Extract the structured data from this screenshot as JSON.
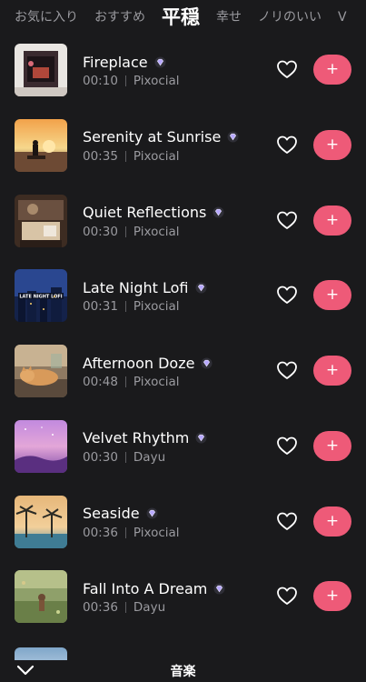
{
  "tabs": [
    {
      "label": "お気に入り",
      "active": false
    },
    {
      "label": "おすすめ",
      "active": false
    },
    {
      "label": "平穏",
      "active": true
    },
    {
      "label": "幸せ",
      "active": false
    },
    {
      "label": "ノリのいい",
      "active": false
    },
    {
      "label": "V",
      "active": false
    }
  ],
  "tracks": [
    {
      "title": "Fireplace",
      "duration": "00:10",
      "source": "Pixocial",
      "thumb_icon": "fireplace-thumbnail"
    },
    {
      "title": "Serenity at Sunrise",
      "duration": "00:35",
      "source": "Pixocial",
      "thumb_icon": "sunrise-thumbnail"
    },
    {
      "title": "Quiet Reflections",
      "duration": "00:30",
      "source": "Pixocial",
      "thumb_icon": "desk-thumbnail"
    },
    {
      "title": "Late Night Lofi",
      "duration": "00:31",
      "source": "Pixocial",
      "thumb_icon": "night-city-thumbnail"
    },
    {
      "title": "Afternoon Doze",
      "duration": "00:48",
      "source": "Pixocial",
      "thumb_icon": "sleeping-cat-thumbnail"
    },
    {
      "title": "Velvet Rhythm",
      "duration": "00:30",
      "source": "Dayu",
      "thumb_icon": "purple-sky-thumbnail"
    },
    {
      "title": "Seaside",
      "duration": "00:36",
      "source": "Pixocial",
      "thumb_icon": "palm-beach-thumbnail"
    },
    {
      "title": "Fall Into A Dream",
      "duration": "00:36",
      "source": "Dayu",
      "thumb_icon": "meadow-thumbnail"
    }
  ],
  "add_label": "+",
  "bottom": {
    "title": "音楽"
  },
  "colors": {
    "background": "#1a1a1c",
    "accent": "#ee5a78",
    "muted_text": "#9a9a9f"
  },
  "icons": {
    "badge": "diamond-badge-icon",
    "favorite": "heart-icon",
    "collapse": "chevron-down-icon"
  }
}
